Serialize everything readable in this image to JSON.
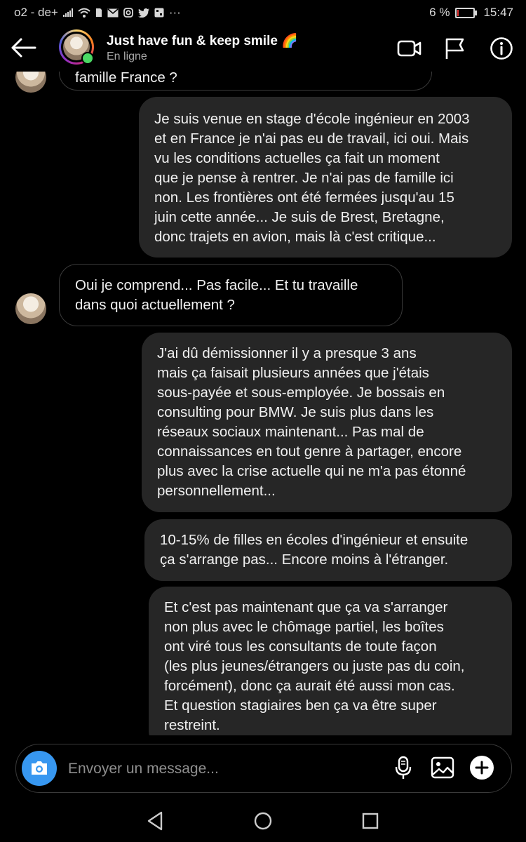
{
  "status_bar": {
    "carrier": "o2 - de+",
    "notification_icons": [
      "signal-icon",
      "wifi-icon",
      "sim-icon",
      "mail-icon",
      "instagram-icon",
      "twitter-icon",
      "gallery-icon",
      "more-icon"
    ],
    "overflow": "···",
    "battery_text": "6 %",
    "battery_level": 0.06,
    "battery_color": "#e33333",
    "time": "15:47"
  },
  "header": {
    "contact_name": "Just have fun & keep smile 🌈",
    "status": "En ligne",
    "online_color": "#4bd964",
    "icons": [
      "back-arrow-icon",
      "video-call-icon",
      "flag-icon",
      "info-icon"
    ]
  },
  "messages": [
    {
      "direction": "in",
      "text": "famille France ?",
      "partial": true
    },
    {
      "direction": "out",
      "lines": [
        "Je suis venue en stage d'école ingénieur en 2003",
        "et en France je n'ai pas eu de travail, ici oui. Mais",
        "vu les conditions actuelles ça fait un moment",
        "que je pense à rentrer. Je n'ai pas de famille ici",
        "non. Les frontières ont été fermées jusqu'au 15",
        "juin cette année... Je suis de Brest, Bretagne,",
        "donc trajets en avion, mais là c'est critique..."
      ]
    },
    {
      "direction": "in",
      "lines": [
        "Oui je comprend... Pas facile... Et tu travaille",
        "dans quoi actuellement ?"
      ]
    },
    {
      "direction": "out",
      "lines": [
        "J'ai dû démissionner il y a presque 3 ans",
        "mais ça faisait plusieurs années que j'étais",
        "sous-payée et sous-employée. Je bossais en",
        "consulting pour BMW. Je suis plus dans les",
        "réseaux sociaux maintenant... Pas mal de",
        "connaissances en tout genre à partager, encore",
        "plus avec la crise actuelle qui ne m'a pas étonné",
        "personnellement..."
      ]
    },
    {
      "direction": "out",
      "lines": [
        "10-15% de filles en écoles d'ingénieur et ensuite",
        "ça s'arrange pas... Encore moins à l'étranger."
      ]
    },
    {
      "direction": "out",
      "lines": [
        "Et c'est pas maintenant que ça va s'arranger",
        "non plus avec le chômage partiel, les boîtes",
        "ont viré tous les consultants de toute façon",
        "(les plus jeunes/étrangers ou juste pas du coin,",
        "forcément), donc ça aurait été aussi mon cas.",
        "Et question stagiaires ben ça va être super",
        "restreint."
      ]
    }
  ],
  "composer": {
    "placeholder": "Envoyer un message...",
    "value": "",
    "icons": [
      "camera-icon",
      "microphone-icon",
      "gallery-icon",
      "plus-icon"
    ],
    "camera_color": "#3797f0"
  },
  "nav_bar": {
    "icons": [
      "back-triangle-icon",
      "home-circle-icon",
      "recents-square-icon"
    ]
  },
  "colors": {
    "background": "#000000",
    "outgoing_bubble": "#262626",
    "incoming_border": "#3a3a3a",
    "text": "#f0f0f0",
    "secondary_text": "#a8a8a8"
  }
}
